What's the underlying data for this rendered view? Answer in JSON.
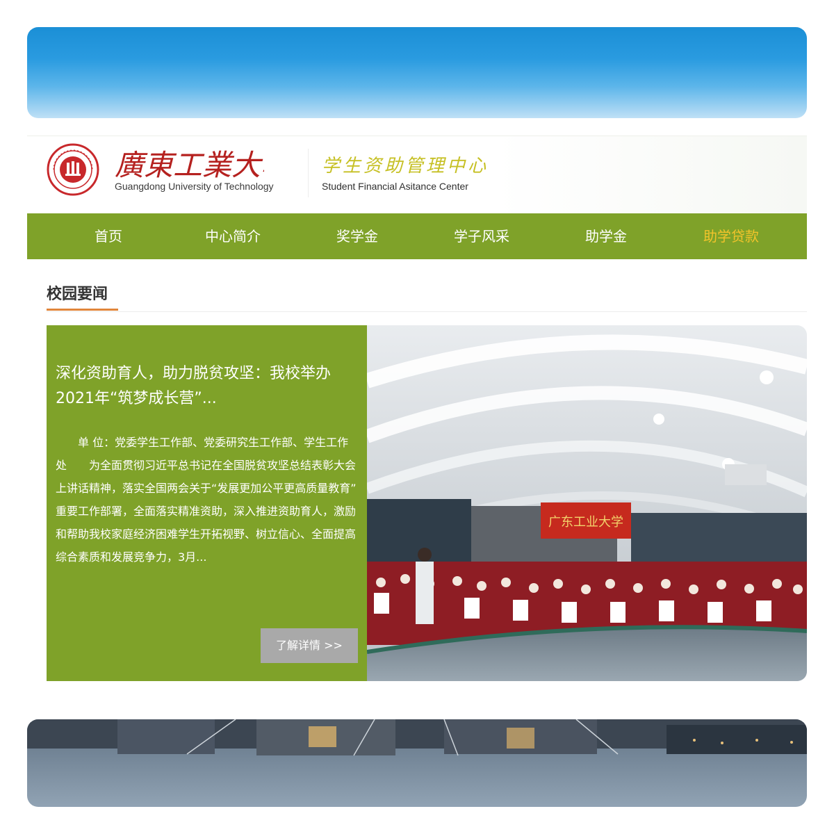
{
  "header": {
    "university_name_zh": "廣東工業大學",
    "university_name_en": "Guangdong University of Technology",
    "center_name_zh": "学生资助管理中心",
    "center_name_en": "Student Financial Asitance Center"
  },
  "nav": {
    "items": [
      {
        "label": "首页"
      },
      {
        "label": "中心简介"
      },
      {
        "label": "奖学金"
      },
      {
        "label": "学子风采"
      },
      {
        "label": "助学金"
      },
      {
        "label": "助学贷款"
      }
    ]
  },
  "section": {
    "title": "校园要闻"
  },
  "news": {
    "title": "深化资助育人，助力脱贫攻坚：我校举办2021年“筑梦成长营”...",
    "body": "　　单 位：党委学生工作部、党委研究生工作部、学生工作处　　为全面贯彻习近平总书记在全国脱贫攻坚总结表彰大会上讲话精神，落实全国两会关于“发展更加公平更高质量教育” 重要工作部署，全面落实精准资助，深入推进资助育人，激励和帮助我校家庭经济困难学生开拓视野、树立信心、全面提高综合素质和发展竞争力，3月...",
    "more_label": "了解详情 >>",
    "photo_banner_text": "广东工业大学"
  },
  "colors": {
    "nav_green": "#7fa229",
    "nav_active": "#f3c42a",
    "accent_orange": "#e1853a",
    "seal_red": "#c8282b"
  },
  "icons": {
    "logo": "university-seal-logo"
  }
}
